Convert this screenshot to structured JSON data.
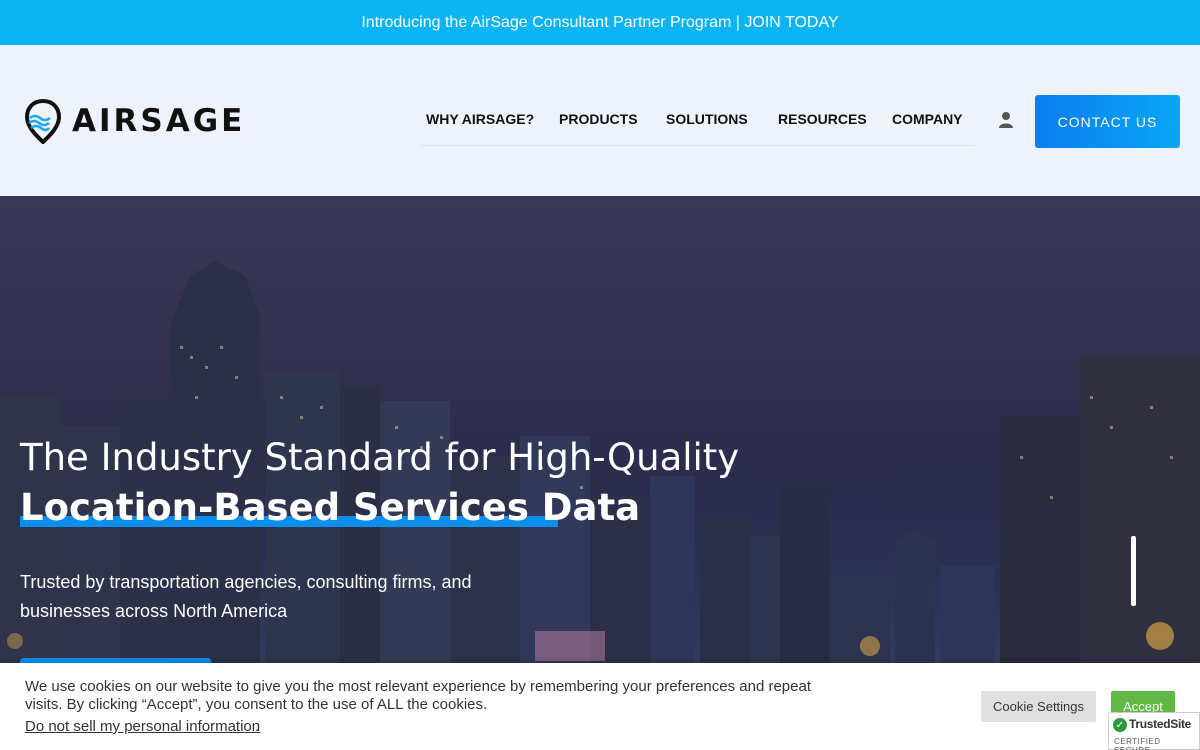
{
  "announcement": {
    "text": "Introducing the AirSage Consultant Partner Program | JOIN TODAY"
  },
  "header": {
    "logo_text": "AIRSAGE",
    "nav": [
      {
        "label": "WHY AIRSAGE?"
      },
      {
        "label": "PRODUCTS"
      },
      {
        "label": "SOLUTIONS"
      },
      {
        "label": "RESOURCES"
      },
      {
        "label": "COMPANY"
      }
    ],
    "user_icon": "user-icon",
    "contact_label": "CONTACT US"
  },
  "hero": {
    "headline_line1": "The Industry Standard for High-Quality",
    "headline_line2": "Location-Based Services Data",
    "subtext": "Trusted by transportation agencies, consulting firms, and businesses across North America"
  },
  "cookie": {
    "text": "We use cookies on our website to give you the most relevant experience by remembering your preferences and repeat visits. By clicking “Accept”, you consent to the use of ALL the cookies.",
    "link": "Do not sell my personal information",
    "link_suffix": ".",
    "settings_label": "Cookie Settings",
    "accept_label": "Accept"
  },
  "trusted_site": {
    "name": "TrustedSite",
    "sub": "CERTIFIED SECURE"
  },
  "colors": {
    "announcement_bg": "#0cb4f4",
    "accent_blue": "#0a8ef0",
    "header_bg": "#eef2fa",
    "accept_green": "#61b845"
  }
}
